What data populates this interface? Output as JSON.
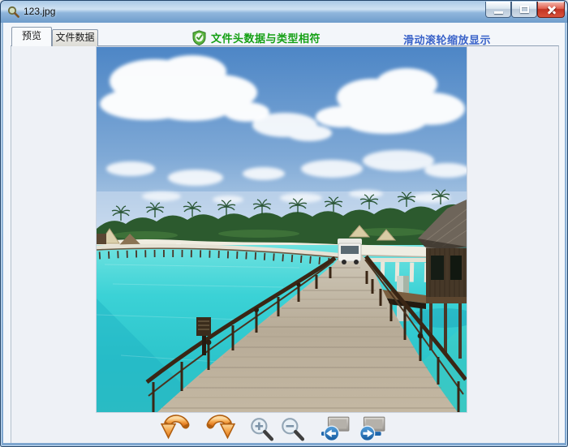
{
  "window": {
    "title": "123.jpg",
    "icon": "magnifier-file-icon",
    "controls": {
      "minimize": "minimize",
      "maximize": "maximize",
      "close": "close"
    }
  },
  "tabs": [
    {
      "label": "预览",
      "active": true
    },
    {
      "label": "文件数据",
      "active": false
    }
  ],
  "header": {
    "check_icon": "shield-check-icon",
    "check_text": "文件头数据与类型相符",
    "hint_text": "滑动滚轮缩放显示"
  },
  "toolbar": {
    "buttons": [
      {
        "name": "rotate-left"
      },
      {
        "name": "rotate-right"
      },
      {
        "name": "zoom-in"
      },
      {
        "name": "zoom-out"
      },
      {
        "name": "previous-image"
      },
      {
        "name": "next-image"
      }
    ]
  },
  "photo": {
    "description": "Wooden boardwalk with dark railings leading over a turquoise lagoon toward a palm-covered island, long stilted jetty, white cart and overwater bungalow under a blue sky with cumulus clouds"
  },
  "colors": {
    "check_green": "#15a015",
    "hint_blue": "#3a63c9",
    "titlebar_blue": "#8fb6dc",
    "water_turquoise": "#2fcdd2",
    "accent_orange": "#ef9a3c",
    "nav_blue": "#1d6cb4"
  }
}
